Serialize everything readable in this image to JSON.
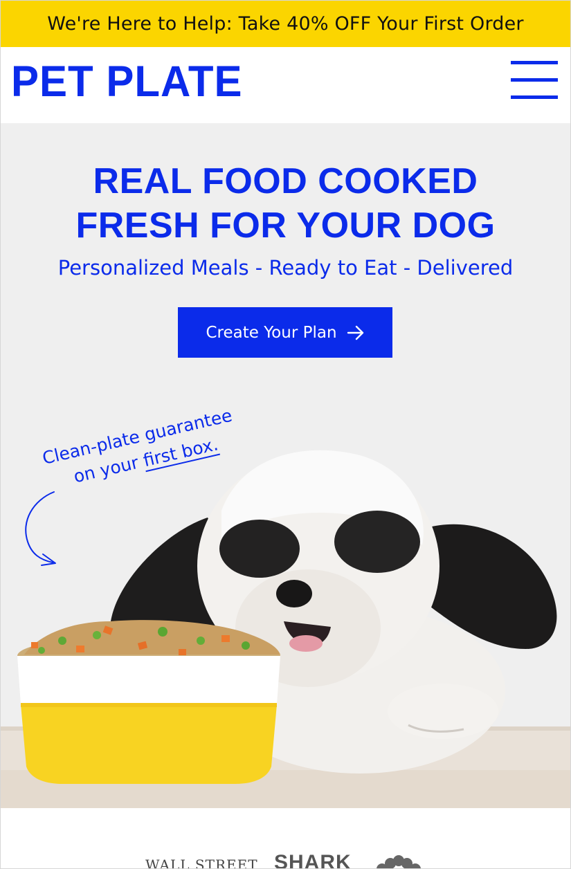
{
  "promo": {
    "text": "We're Here to Help: Take 40% OFF Your First Order"
  },
  "header": {
    "logo": "PET PLATE",
    "menu_icon": "hamburger-menu-icon"
  },
  "hero": {
    "headline_line1": "REAL FOOD COOKED",
    "headline_line2": "FRESH FOR YOUR DOG",
    "subhead": "Personalized Meals - Ready to Eat - Delivered",
    "cta_label": "Create Your Plan",
    "cta_icon": "arrow-right-icon",
    "guarantee_line1": "Clean-plate guarantee",
    "guarantee_line2_a": "on your ",
    "guarantee_line2_b": "first box."
  },
  "press": {
    "logos": [
      "WALL STREET",
      "SHARK",
      "nbc-peacock-logo"
    ]
  },
  "colors": {
    "brand_blue": "#0b2bea",
    "promo_yellow": "#fbd500",
    "hero_bg": "#efefef",
    "bowl_yellow": "#f8d322"
  }
}
